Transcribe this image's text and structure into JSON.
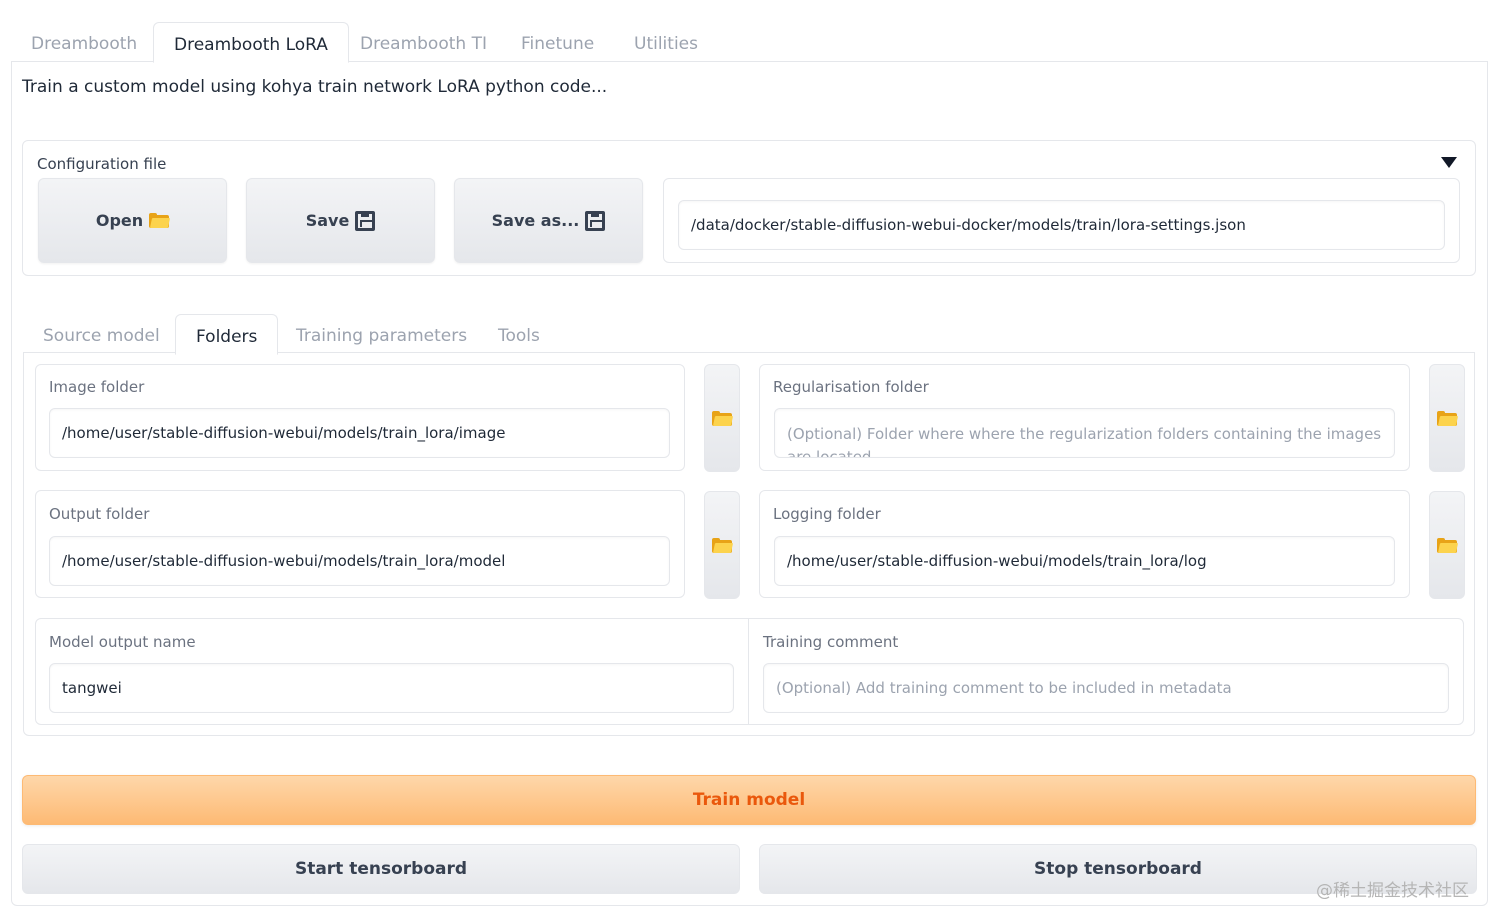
{
  "top_tabs": [
    "Dreambooth",
    "Dreambooth LoRA",
    "Dreambooth TI",
    "Finetune",
    "Utilities"
  ],
  "description": "Train a custom model using kohya train network LoRA python code...",
  "config": {
    "label": "Configuration file",
    "open_label": "Open",
    "save_label": "Save",
    "save_as_label": "Save as...",
    "path": "/data/docker/stable-diffusion-webui-docker/models/train/lora-settings.json"
  },
  "sub_tabs": [
    "Source model",
    "Folders",
    "Training parameters",
    "Tools"
  ],
  "folders": {
    "image_label": "Image folder",
    "image_value": "/home/user/stable-diffusion-webui/models/train_lora/image",
    "reg_label": "Regularisation folder",
    "reg_placeholder": "(Optional) Folder where where the regularization folders containing the images are located",
    "output_label": "Output folder",
    "output_value": "/home/user/stable-diffusion-webui/models/train_lora/model",
    "log_label": "Logging folder",
    "log_value": "/home/user/stable-diffusion-webui/models/train_lora/log",
    "model_name_label": "Model output name",
    "model_name_value": "tangwei",
    "comment_label": "Training comment",
    "comment_placeholder": "(Optional) Add training comment to be included in metadata"
  },
  "actions": {
    "train": "Train model",
    "start_tb": "Start tensorboard",
    "stop_tb": "Stop tensorboard"
  },
  "watermark": "@稀土掘金技术社区",
  "colors": {
    "accent": "#ea580c",
    "train_bg": "#fdba74",
    "folder_icon": "#fcd34d"
  }
}
